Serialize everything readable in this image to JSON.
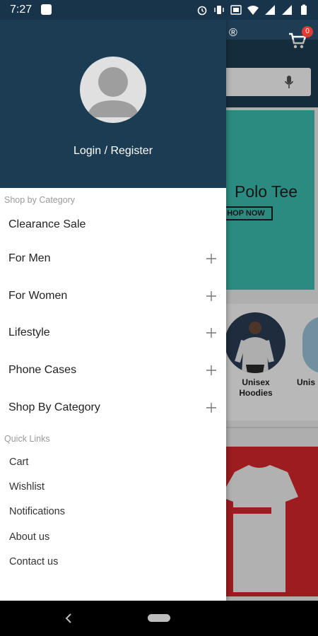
{
  "status_bar": {
    "time": "7:27"
  },
  "background": {
    "logo_mark": "®",
    "cart_count": "0",
    "banner_title": "Polo Tee",
    "banner_button": "HOP NOW",
    "category_1": "Unisex Hoodies",
    "category_2": "Unis"
  },
  "drawer": {
    "login_label": "Login / Register",
    "shop_section_label": "Shop by Category",
    "categories": [
      {
        "label": "Clearance Sale",
        "expandable": false
      },
      {
        "label": "For Men",
        "expandable": true
      },
      {
        "label": "For Women",
        "expandable": true
      },
      {
        "label": "Lifestyle",
        "expandable": true
      },
      {
        "label": "Phone Cases",
        "expandable": true
      },
      {
        "label": "Shop By Category",
        "expandable": true
      }
    ],
    "quick_section_label": "Quick Links",
    "quick_links": [
      {
        "label": "Cart"
      },
      {
        "label": "Wishlist"
      },
      {
        "label": "Notifications"
      },
      {
        "label": "About us"
      },
      {
        "label": "Contact us"
      }
    ]
  }
}
